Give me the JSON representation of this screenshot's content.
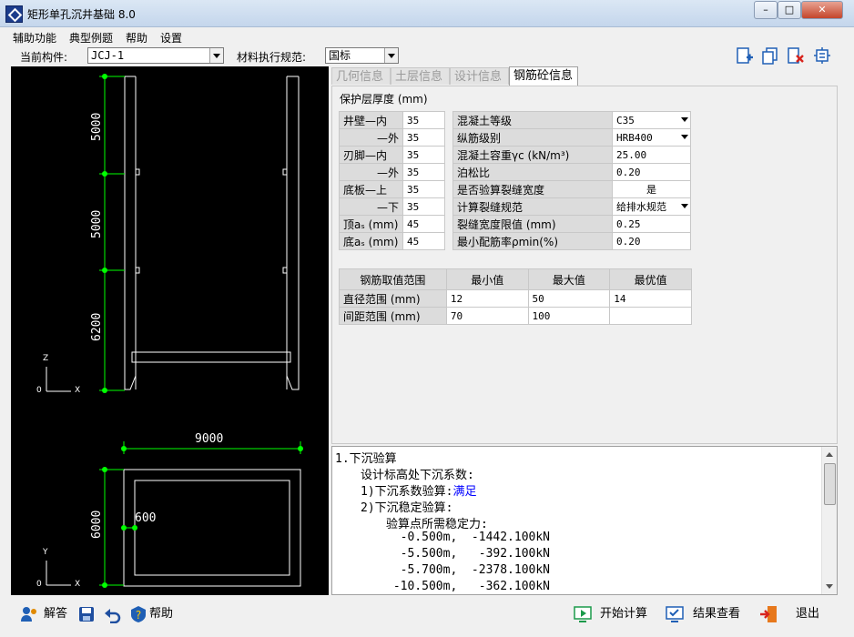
{
  "window": {
    "title": "矩形单孔沉井基础 8.0",
    "minimize": "–",
    "maximize": "□",
    "close": "✕"
  },
  "menu": [
    "辅助功能",
    "典型例题",
    "帮助",
    "设置"
  ],
  "toolbar": {
    "component_label": "当前构件:",
    "component_value": "JCJ-1",
    "code_label": "材料执行规范:",
    "code_value": "国标"
  },
  "tabs": [
    "几何信息",
    "土层信息",
    "设计信息",
    "钢筋砼信息"
  ],
  "active_tab": "钢筋砼信息",
  "cover": {
    "title": "保护层厚度 (mm)",
    "rows": [
      {
        "label": "井壁—内",
        "value": "35"
      },
      {
        "label": "—外",
        "value": "35"
      },
      {
        "label": "刃脚—内",
        "value": "35"
      },
      {
        "label": "—外",
        "value": "35"
      },
      {
        "label": "底板—上",
        "value": "35"
      },
      {
        "label": "—下",
        "value": "35"
      },
      {
        "label": "顶aₛ (mm)",
        "value": "45"
      },
      {
        "label": "底aₛ (mm)",
        "value": "45"
      }
    ]
  },
  "props": [
    {
      "label": "混凝土等级",
      "value": "C35",
      "dropdown": true
    },
    {
      "label": "纵筋级别",
      "value": "HRB400",
      "dropdown": true
    },
    {
      "label": "混凝土容重γc (kN/m³)",
      "value": "25.00",
      "dropdown": false
    },
    {
      "label": "泊松比",
      "value": "0.20",
      "dropdown": false
    },
    {
      "label": "是否验算裂缝宽度",
      "value": "是",
      "dropdown": false
    },
    {
      "label": "计算裂缝规范",
      "value": "给排水规范",
      "dropdown": true
    },
    {
      "label": "裂缝宽度限值 (mm)",
      "value": "0.25",
      "dropdown": false
    },
    {
      "label": "最小配筋率ρmin(%)",
      "value": "0.20",
      "dropdown": false
    }
  ],
  "rebar": {
    "headers": [
      "钢筋取值范围",
      "最小值",
      "最大值",
      "最优值"
    ],
    "rows": [
      [
        "直径范围 (mm)",
        "12",
        "50",
        "14"
      ],
      [
        "间距范围 (mm)",
        "70",
        "100",
        ""
      ]
    ]
  },
  "drawing": {
    "elev_dims": [
      "5000",
      "5000",
      "6200"
    ],
    "plan_width": "9000",
    "plan_height": "6000",
    "plan_wall": "600",
    "axis_z": "Z",
    "axis_x": "X",
    "axis_y": "Y",
    "origin": "0"
  },
  "output_lines": [
    {
      "text": "1.下沉验算",
      "indent": 0
    },
    {
      "text": "设计标高处下沉系数:",
      "indent": 2
    },
    {
      "text": "1)下沉系数验算:",
      "indent": 2,
      "suffix": "满足"
    },
    {
      "text": "2)下沉稳定验算:",
      "indent": 2
    },
    {
      "text": "验算点所需稳定力:",
      "indent": 4
    },
    {
      "text": "  -0.500m,  -1442.100kN",
      "indent": 4
    },
    {
      "text": "  -5.500m,   -392.100kN",
      "indent": 4
    },
    {
      "text": "  -5.700m,  -2378.100kN",
      "indent": 4
    },
    {
      "text": " -10.500m,   -362.100kN",
      "indent": 4
    }
  ],
  "bottom": {
    "help_answer": "解答",
    "help": "帮助",
    "start": "开始计算",
    "results": "结果查看",
    "exit": "退出"
  },
  "colors": {
    "accent": "#1b3c8c",
    "dim_green": "#00ff00",
    "link_blue": "#0000ff"
  }
}
